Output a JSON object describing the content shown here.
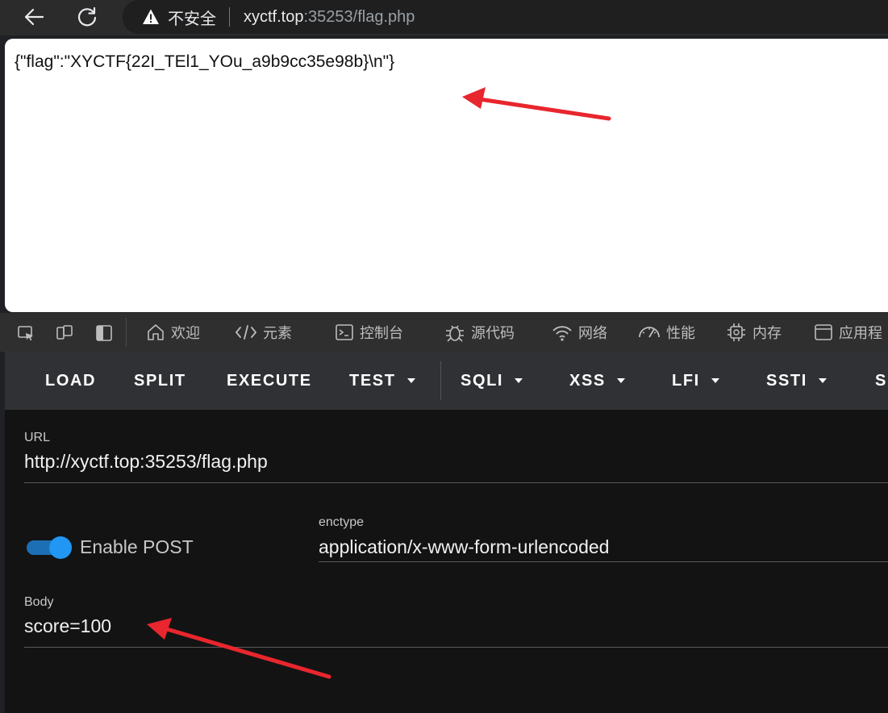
{
  "browser": {
    "security_label": "不安全",
    "url_host": "xyctf.top",
    "url_rest": ":35253/flag.php"
  },
  "page": {
    "body_text": "{\"flag\":\"XYCTF{22I_TEl1_YOu_a9b9cc35e98b}\\n\"}"
  },
  "devtools": {
    "tabs": [
      {
        "label": "欢迎",
        "icon": "home-icon"
      },
      {
        "label": "元素",
        "icon": "code-icon"
      },
      {
        "label": "控制台",
        "icon": "console-icon"
      },
      {
        "label": "源代码",
        "icon": "bug-icon"
      },
      {
        "label": "网络",
        "icon": "wifi-icon"
      },
      {
        "label": "性能",
        "icon": "gauge-icon"
      },
      {
        "label": "内存",
        "icon": "chip-icon"
      },
      {
        "label": "应用程",
        "icon": "app-icon"
      }
    ]
  },
  "hackbar": {
    "buttons": [
      {
        "label": "LOAD",
        "dropdown": false
      },
      {
        "label": "SPLIT",
        "dropdown": false
      },
      {
        "label": "EXECUTE",
        "dropdown": false
      },
      {
        "label": "TEST",
        "dropdown": true
      },
      {
        "label": "SQLI",
        "dropdown": true
      },
      {
        "label": "XSS",
        "dropdown": true
      },
      {
        "label": "LFI",
        "dropdown": true
      },
      {
        "label": "SSTI",
        "dropdown": true
      },
      {
        "label": "S",
        "dropdown": false
      }
    ],
    "url_label": "URL",
    "url_value": "http://xyctf.top:35253/flag.php",
    "enable_post_label": "Enable POST",
    "enable_post_on": true,
    "enctype_label": "enctype",
    "enctype_value": "application/x-www-form-urlencoded",
    "body_label": "Body",
    "body_value": "score=100"
  },
  "colors": {
    "annotation_arrow": "#e8262d",
    "toggle_on": "#2196f3"
  }
}
